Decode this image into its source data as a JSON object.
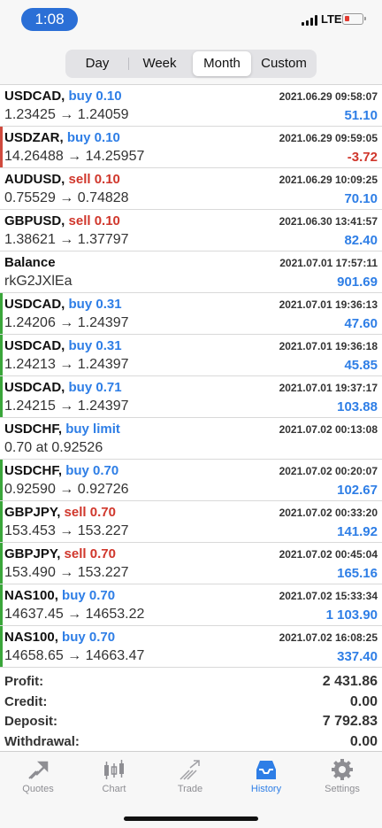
{
  "status_bar": {
    "time": "1:08",
    "network": "LTE"
  },
  "period_tabs": [
    {
      "label": "Day",
      "active": false
    },
    {
      "label": "Week",
      "active": false
    },
    {
      "label": "Month",
      "active": true
    },
    {
      "label": "Custom",
      "active": false
    }
  ],
  "history": [
    {
      "symbol": "USDCAD,",
      "action": "buy 0.10",
      "side": "buy",
      "prices": "1.23425 → 1.24059",
      "time": "2021.06.29 09:58:07",
      "value": "51.10",
      "sign": "pos",
      "marker": "none"
    },
    {
      "symbol": "USDZAR,",
      "action": "buy 0.10",
      "side": "buy",
      "prices": "14.26488 → 14.25957",
      "time": "2021.06.29 09:59:05",
      "value": "-3.72",
      "sign": "neg",
      "marker": "red"
    },
    {
      "symbol": "AUDUSD,",
      "action": "sell 0.10",
      "side": "sell",
      "prices": "0.75529 → 0.74828",
      "time": "2021.06.29 10:09:25",
      "value": "70.10",
      "sign": "pos",
      "marker": "none"
    },
    {
      "symbol": "GBPUSD,",
      "action": "sell 0.10",
      "side": "sell",
      "prices": "1.38621 → 1.37797",
      "time": "2021.06.30 13:41:57",
      "value": "82.40",
      "sign": "pos",
      "marker": "none"
    },
    {
      "symbol": "Balance",
      "action": "",
      "side": "none",
      "prices": "rkG2JXlEa",
      "time": "2021.07.01 17:57:11",
      "value": "901.69",
      "sign": "pos",
      "marker": "none"
    },
    {
      "symbol": "USDCAD,",
      "action": "buy 0.31",
      "side": "buy",
      "prices": "1.24206 → 1.24397",
      "time": "2021.07.01 19:36:13",
      "value": "47.60",
      "sign": "pos",
      "marker": "green"
    },
    {
      "symbol": "USDCAD,",
      "action": "buy 0.31",
      "side": "buy",
      "prices": "1.24213 → 1.24397",
      "time": "2021.07.01 19:36:18",
      "value": "45.85",
      "sign": "pos",
      "marker": "green"
    },
    {
      "symbol": "USDCAD,",
      "action": "buy 0.71",
      "side": "buy",
      "prices": "1.24215 → 1.24397",
      "time": "2021.07.01 19:37:17",
      "value": "103.88",
      "sign": "pos",
      "marker": "green"
    },
    {
      "symbol": "USDCHF,",
      "action": "buy limit",
      "side": "buy",
      "prices": "0.70 at 0.92526",
      "time": "2021.07.02 00:13:08",
      "value": "",
      "sign": "pos",
      "marker": "none"
    },
    {
      "symbol": "USDCHF,",
      "action": "buy 0.70",
      "side": "buy",
      "prices": "0.92590 → 0.92726",
      "time": "2021.07.02 00:20:07",
      "value": "102.67",
      "sign": "pos",
      "marker": "green"
    },
    {
      "symbol": "GBPJPY,",
      "action": "sell 0.70",
      "side": "sell",
      "prices": "153.453 → 153.227",
      "time": "2021.07.02 00:33:20",
      "value": "141.92",
      "sign": "pos",
      "marker": "green"
    },
    {
      "symbol": "GBPJPY,",
      "action": "sell 0.70",
      "side": "sell",
      "prices": "153.490 → 153.227",
      "time": "2021.07.02 00:45:04",
      "value": "165.16",
      "sign": "pos",
      "marker": "green"
    },
    {
      "symbol": "NAS100,",
      "action": "buy 0.70",
      "side": "buy",
      "prices": "14637.45 → 14653.22",
      "time": "2021.07.02 15:33:34",
      "value": "1 103.90",
      "sign": "pos",
      "marker": "green"
    },
    {
      "symbol": "NAS100,",
      "action": "buy 0.70",
      "side": "buy",
      "prices": "14658.65 → 14663.47",
      "time": "2021.07.02 16:08:25",
      "value": "337.40",
      "sign": "pos",
      "marker": "green"
    }
  ],
  "summary": [
    {
      "label": "Profit:",
      "value": "2 431.86"
    },
    {
      "label": "Credit:",
      "value": "0.00"
    },
    {
      "label": "Deposit:",
      "value": "7 792.83"
    },
    {
      "label": "Withdrawal:",
      "value": "0.00"
    }
  ],
  "tabbar": [
    {
      "label": "Quotes",
      "icon": "quotes-icon",
      "active": false
    },
    {
      "label": "Chart",
      "icon": "chart-icon",
      "active": false
    },
    {
      "label": "Trade",
      "icon": "trade-icon",
      "active": false
    },
    {
      "label": "History",
      "icon": "history-icon",
      "active": true
    },
    {
      "label": "Settings",
      "icon": "settings-icon",
      "active": false
    }
  ],
  "colors": {
    "accent": "#2e7ee6",
    "loss": "#d0372c",
    "profit_marker": "#3aa63a"
  }
}
